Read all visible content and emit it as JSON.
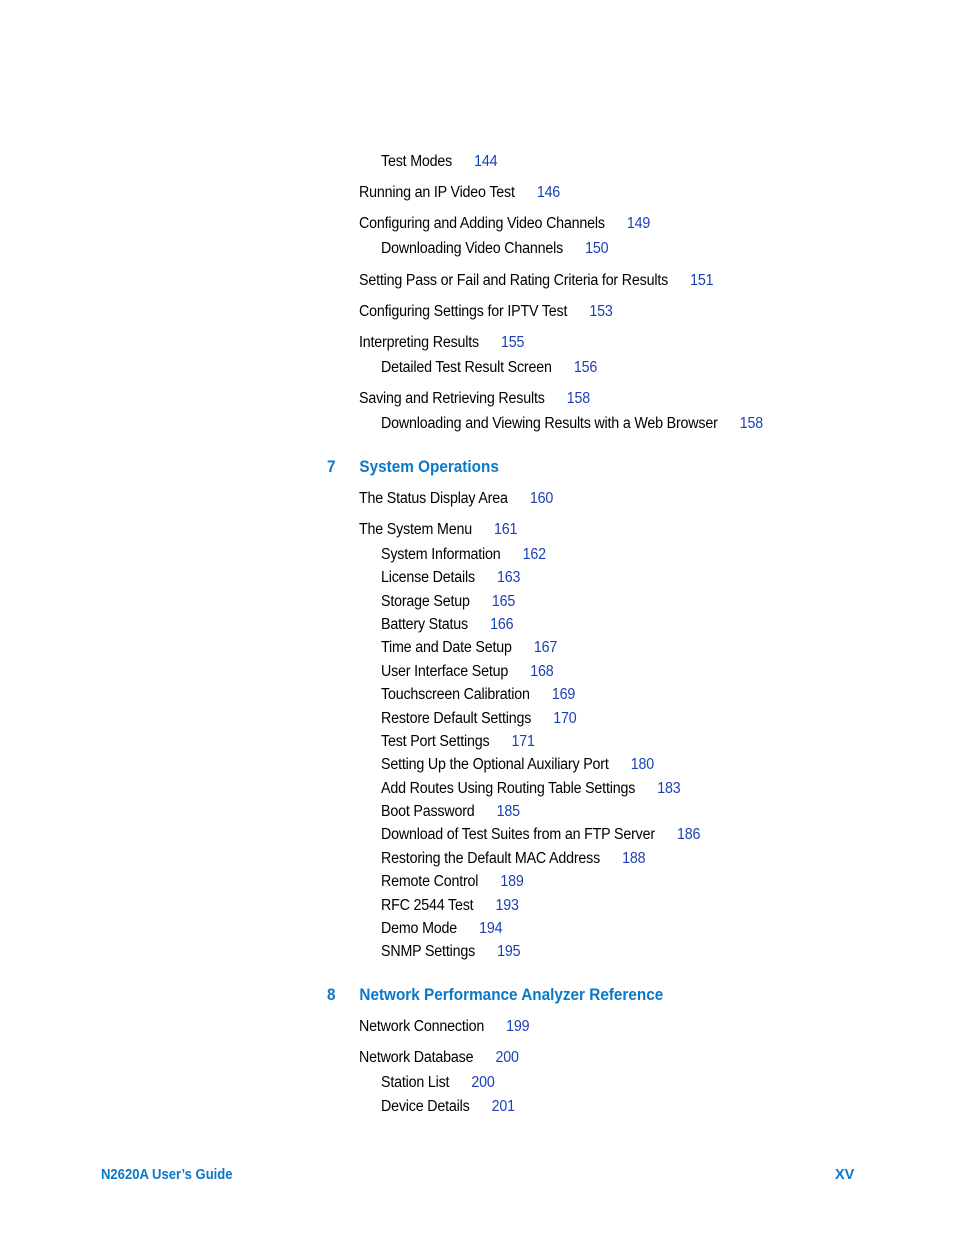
{
  "toc": {
    "continued_entries": [
      {
        "title": "Test Modes",
        "page": "144",
        "level": 2
      },
      {
        "title": "Running an IP Video Test",
        "page": "146",
        "level": 1
      },
      {
        "title": "Configuring and Adding Video Channels",
        "page": "149",
        "level": 1
      },
      {
        "title": "Downloading Video Channels",
        "page": "150",
        "level": 2
      },
      {
        "title": "Setting Pass or Fail and Rating Criteria for Results",
        "page": "151",
        "level": 1
      },
      {
        "title": "Configuring Settings for IPTV Test",
        "page": "153",
        "level": 1
      },
      {
        "title": "Interpreting Results",
        "page": "155",
        "level": 1
      },
      {
        "title": "Detailed Test Result Screen",
        "page": "156",
        "level": 2
      },
      {
        "title": "Saving and Retrieving Results",
        "page": "158",
        "level": 1
      },
      {
        "title": "Downloading and Viewing Results with a Web Browser",
        "page": "158",
        "level": 2
      }
    ],
    "chapters": [
      {
        "number": "7",
        "title": "System Operations",
        "entries": [
          {
            "title": "The Status Display Area",
            "page": "160",
            "level": 1
          },
          {
            "title": "The System Menu",
            "page": "161",
            "level": 1
          },
          {
            "title": "System Information",
            "page": "162",
            "level": 2
          },
          {
            "title": "License Details",
            "page": "163",
            "level": 2
          },
          {
            "title": "Storage Setup",
            "page": "165",
            "level": 2
          },
          {
            "title": "Battery Status",
            "page": "166",
            "level": 2
          },
          {
            "title": "Time and Date Setup",
            "page": "167",
            "level": 2
          },
          {
            "title": "User Interface Setup",
            "page": "168",
            "level": 2
          },
          {
            "title": "Touchscreen Calibration",
            "page": "169",
            "level": 2
          },
          {
            "title": "Restore Default Settings",
            "page": "170",
            "level": 2
          },
          {
            "title": "Test Port Settings",
            "page": "171",
            "level": 2
          },
          {
            "title": "Setting Up the Optional Auxiliary Port",
            "page": "180",
            "level": 2
          },
          {
            "title": "Add Routes Using Routing Table Settings",
            "page": "183",
            "level": 2
          },
          {
            "title": "Boot Password",
            "page": "185",
            "level": 2
          },
          {
            "title": "Download of Test Suites from an FTP Server",
            "page": "186",
            "level": 2
          },
          {
            "title": "Restoring the Default MAC Address",
            "page": "188",
            "level": 2
          },
          {
            "title": "Remote Control",
            "page": "189",
            "level": 2
          },
          {
            "title": "RFC 2544 Test",
            "page": "193",
            "level": 2
          },
          {
            "title": "Demo Mode",
            "page": "194",
            "level": 2
          },
          {
            "title": "SNMP Settings",
            "page": "195",
            "level": 2
          }
        ]
      },
      {
        "number": "8",
        "title": "Network Performance Analyzer Reference",
        "entries": [
          {
            "title": "Network Connection",
            "page": "199",
            "level": 1
          },
          {
            "title": "Network Database",
            "page": "200",
            "level": 1
          },
          {
            "title": "Station List",
            "page": "200",
            "level": 2
          },
          {
            "title": "Device Details",
            "page": "201",
            "level": 2
          }
        ]
      }
    ]
  },
  "footer": {
    "doc_title": "N2620A User’s Guide",
    "page_number": "XV"
  },
  "colors": {
    "chapter_heading": "#0a78c8",
    "page_link": "#1a3fb5",
    "text": "#000000"
  }
}
